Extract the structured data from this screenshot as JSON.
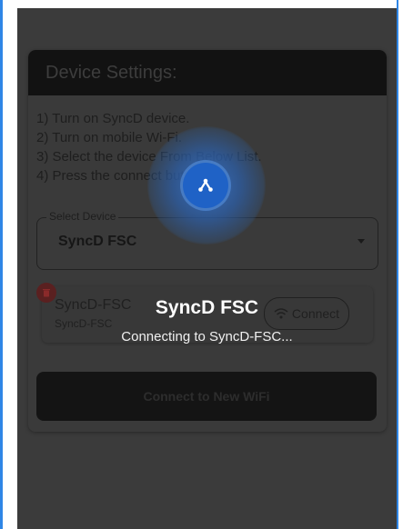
{
  "card": {
    "title": "Device Settings:",
    "steps": [
      "1) Turn on SyncD device.",
      "2) Turn on mobile Wi-Fi.",
      "3) Select the device From Below List.",
      "4) Press the connect button."
    ]
  },
  "select": {
    "legend": "Select Device",
    "value": "SyncD FSC"
  },
  "device": {
    "name": "SyncD-FSC",
    "sub": "SyncD-FSC",
    "connect_label": "Connect"
  },
  "connect_wifi_label": "Connect to New WiFi",
  "overlay": {
    "title": "SyncD FSC",
    "subtitle": "Connecting to SyncD-FSC..."
  },
  "icons": {
    "overlay": "share-nodes-icon",
    "delete": "trash-icon",
    "wifi": "wifi-icon"
  },
  "colors": {
    "accent": "#1f62c6",
    "frame": "#2f86e6"
  }
}
